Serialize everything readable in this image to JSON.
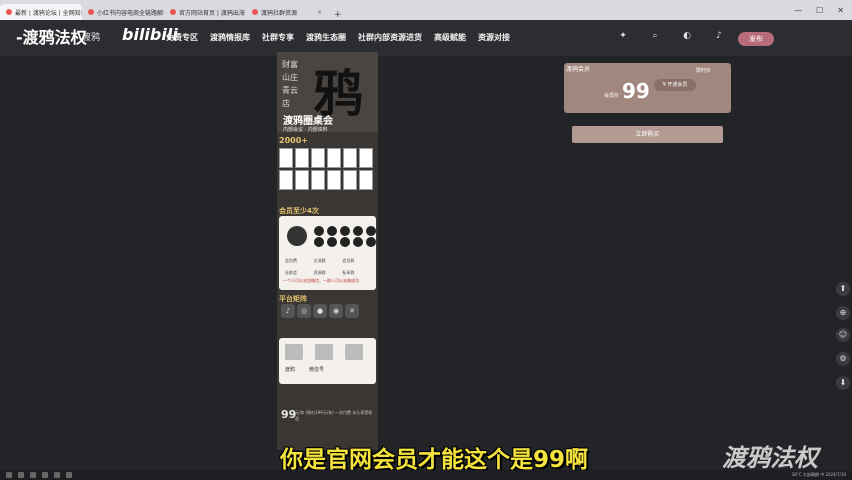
{
  "browser": {
    "tabs": [
      {
        "label": "最新 | 渡鸦论坛 | 全网知识付费"
      },
      {
        "label": "小红书内容电商全链路解析"
      },
      {
        "label": "官方网站首页 | 渡鸦出海"
      },
      {
        "label": "渡鸦社群资源"
      }
    ],
    "new_tab": "+",
    "window_controls": {
      "minimize": "—",
      "maximize": "☐",
      "close": "✕"
    }
  },
  "header": {
    "logo_text": "-渡鸦法权",
    "logo_sub": "渡鸦",
    "partner_logo": "bilibili",
    "nav": [
      "免费专区",
      "渡鸦情报库",
      "社群专享",
      "渡鸦生态圈",
      "社群内部资源进货",
      "高级赋能",
      "资源对接"
    ],
    "icons": [
      "bulb-icon",
      "search-icon",
      "theme-icon",
      "bell-icon"
    ],
    "publish_label": "发布"
  },
  "poster": {
    "tags": "财富山庄 青云店",
    "big_char": "鸦",
    "title": "渡鸦圈桌会",
    "subtitle": "内部会议 · 内部资料",
    "count": "2000+",
    "section_members": "会员至少4次",
    "card_rows": [
      "会员费",
      "交流群",
      "会员群",
      "社群会",
      "资源群",
      "私享群"
    ],
    "card_foot": "一个人可以去加微信，一群人可以去做成功",
    "section_channels": "平台矩阵",
    "social": [
      "♪",
      "◎",
      "●",
      "◉",
      "✕"
    ],
    "card2_labels": [
      "渡鸦",
      "微信号"
    ],
    "price": "99",
    "price_note": "元/年 (原价199元/年) 一次付费 永久享受权益"
  },
  "vip": {
    "label": "渡鸦会员",
    "tag": "限时价",
    "price_label": "会员价",
    "price": "99",
    "button": "¥ 开通会员",
    "buy_button": "立即购买"
  },
  "floating": [
    "⬆",
    "⊕",
    "☺",
    "⚙",
    "⬇"
  ],
  "subtitle": "你是官网会员才能这个是99啊",
  "watermark": "渡鸦法权",
  "taskbar": {
    "tray": "36°C 大部晴朗 中 2024/7/10"
  }
}
